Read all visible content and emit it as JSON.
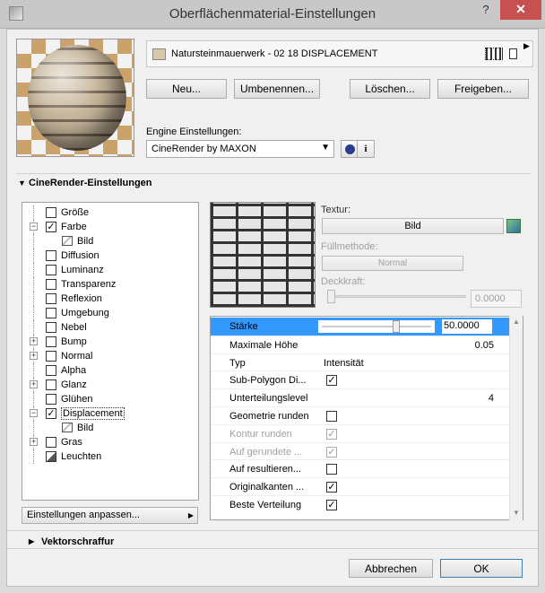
{
  "window": {
    "title": "Oberflächenmaterial-Einstellungen",
    "help": "?",
    "close": "✕"
  },
  "material": {
    "name": "Natursteinmauerwerk - 02 18 DISPLACEMENT",
    "swatch_color": "#d9c9a8"
  },
  "buttons": {
    "new": "Neu...",
    "rename": "Umbenennen...",
    "delete": "Löschen...",
    "share": "Freigeben..."
  },
  "engine": {
    "label": "Engine Einstellungen:",
    "selected": "CineRender by MAXON",
    "info": "i"
  },
  "section": {
    "cinerender": "CineRender-Einstellungen",
    "hatch": "Vektorschraffur"
  },
  "tree": [
    {
      "label": "Größe"
    },
    {
      "label": "Farbe",
      "checked": true
    },
    {
      "label": "Bild"
    },
    {
      "label": "Diffusion",
      "checked": false
    },
    {
      "label": "Luminanz",
      "checked": false
    },
    {
      "label": "Transparenz",
      "checked": false
    },
    {
      "label": "Reflexion",
      "checked": false
    },
    {
      "label": "Umgebung",
      "checked": false
    },
    {
      "label": "Nebel",
      "checked": false
    },
    {
      "label": "Bump",
      "checked": false
    },
    {
      "label": "Normal",
      "checked": false
    },
    {
      "label": "Alpha",
      "checked": false
    },
    {
      "label": "Glanz",
      "checked": false
    },
    {
      "label": "Glühen",
      "checked": false
    },
    {
      "label": "Displacement",
      "checked": true
    },
    {
      "label": "Bild"
    },
    {
      "label": "Gras",
      "checked": false
    },
    {
      "label": "Leuchten"
    }
  ],
  "adjust_button": "Einstellungen anpassen...",
  "texture": {
    "label": "Textur:",
    "button": "Bild",
    "fill_label": "Füllmethode:",
    "fill_value": "Normal",
    "opacity_label": "Deckkraft:",
    "opacity_value": "0.0000"
  },
  "params": [
    {
      "label": "Stärke",
      "value": "50.0000",
      "slider_fraction": 0.5
    },
    {
      "label": "Maximale Höhe",
      "value": "0.05"
    },
    {
      "label": "Typ",
      "value": "Intensität"
    },
    {
      "label": "Sub-Polygon Di...",
      "checked": true
    },
    {
      "label": "Unterteilungslevel",
      "value": "4"
    },
    {
      "label": "Geometrie runden",
      "checked": false
    },
    {
      "label": "Kontur runden",
      "checked": true
    },
    {
      "label": "Auf gerundete ...",
      "checked": true
    },
    {
      "label": "Auf resultieren...",
      "checked": false
    },
    {
      "label": "Originalkanten ...",
      "checked": true
    },
    {
      "label": "Beste Verteilung",
      "checked": true
    }
  ],
  "footer": {
    "cancel": "Abbrechen",
    "ok": "OK"
  }
}
